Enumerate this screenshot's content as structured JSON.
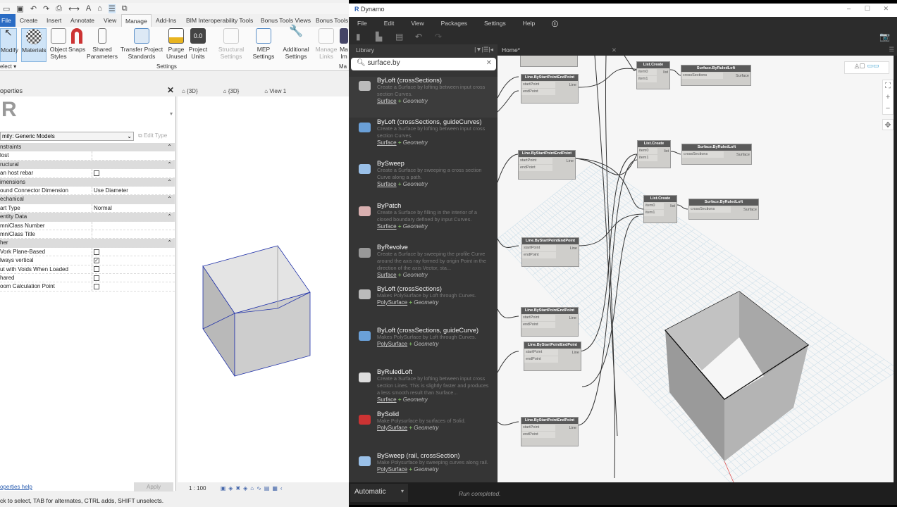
{
  "revit": {
    "tabs": [
      "File",
      "Create",
      "Insert",
      "Annotate",
      "View",
      "Manage",
      "Add-Ins",
      "BIM Interoperability Tools",
      "Bonus Tools Views",
      "Bonus Tools"
    ],
    "ribbon": {
      "modify": "Modify",
      "select": "elect",
      "materials": "Materials",
      "object_styles": "Object Styles",
      "snaps": "Snaps",
      "shared_parameters": "Shared Parameters",
      "transfer": "Transfer Project Standards",
      "purge": "Purge Unused",
      "project_units": "Project Units",
      "structural": "Structural Settings",
      "mep": "MEP Settings",
      "additional": "Additional Settings",
      "manage_links": "Manage Links",
      "ma": "Ma Im",
      "settings_group": "Settings",
      "ma_group": "Ma"
    },
    "properties": {
      "title": "operties",
      "family": "mily: Generic Models",
      "edit_type": "Edit Type",
      "help": "operties help",
      "apply": "Apply",
      "rows": [
        {
          "label": "nstraints",
          "group": true
        },
        {
          "label": "lost",
          "value": ""
        },
        {
          "label": "ructural",
          "group": true
        },
        {
          "label": "an host rebar",
          "check": false
        },
        {
          "label": "imensions",
          "group": true
        },
        {
          "label": "ound Connector Dimension",
          "value": "Use Diameter"
        },
        {
          "label": "echanical",
          "group": true
        },
        {
          "label": "art Type",
          "value": "Normal"
        },
        {
          "label": "entity Data",
          "group": true
        },
        {
          "label": "mniClass Number",
          "value": ""
        },
        {
          "label": "mniClass Title",
          "value": ""
        },
        {
          "label": "her",
          "group": true
        },
        {
          "label": "Vork Plane-Based",
          "check": false
        },
        {
          "label": "lways vertical",
          "check": true
        },
        {
          "label": "ut with Voids When Loaded",
          "check": false
        },
        {
          "label": "hared",
          "check": false
        },
        {
          "label": "oom Calculation Point",
          "check": false
        }
      ]
    },
    "view_tabs": [
      "{3D}",
      "{3D}",
      "View 1"
    ],
    "scale": "1 : 100",
    "status": "ck to select, TAB for alternates, CTRL adds, SHIFT unselects."
  },
  "dynamo": {
    "title": "Dynamo",
    "menu": [
      "File",
      "Edit",
      "View",
      "Packages",
      "Settings",
      "Help"
    ],
    "library_title": "Library",
    "search": "surface.by",
    "home_tab": "Home*",
    "items": [
      {
        "name": "ByLoft",
        "args": " (crossSections)",
        "desc": "Create a Surface by lofting between input cross section Curves.",
        "cat": "Surface",
        "lib": "Geometry",
        "color": "#bbb"
      },
      {
        "name": "ByLoft",
        "args": " (crossSections, guideCurves)",
        "desc": "Create a Surface by lofting between input cross section Curves.",
        "cat": "Surface",
        "lib": "Geometry",
        "color": "#6aa0d8"
      },
      {
        "name": "BySweep",
        "args": "",
        "desc": "Create a Surface by sweeping a cross section Curve along a path.",
        "cat": "Surface",
        "lib": "Geometry",
        "color": "#9ac0e8"
      },
      {
        "name": "ByPatch",
        "args": "",
        "desc": "Create a Surface by filling in the interior of a closed boundary defined by input Curves.",
        "cat": "Surface",
        "lib": "Geometry",
        "color": "#d9b0b0"
      },
      {
        "name": "ByRevolve",
        "args": "",
        "desc": "Create a Surface by sweeping the profile Curve around the axis ray formed by origin Point in the direction of the axis Vector, sta...",
        "cat": "Surface",
        "lib": "Geometry",
        "color": "#999"
      },
      {
        "name": "ByLoft",
        "args": " (crossSections)",
        "desc": "Makes PolySurface by Loft through Curves.",
        "cat": "PolySurface",
        "lib": "Geometry",
        "color": "#bbb"
      },
      {
        "name": "ByLoft",
        "args": " (crossSections, guideCurve)",
        "desc": "Makes PolySurface by Loft through Curves.",
        "cat": "PolySurface",
        "lib": "Geometry",
        "color": "#6aa0d8"
      },
      {
        "name": "ByRuledLoft",
        "args": "",
        "desc": "Create a Surface by lofting between input cross section Lines. This is slightly faster and produces a less smooth result than Surface...",
        "cat": "Surface",
        "lib": "Geometry",
        "color": "#ddd"
      },
      {
        "name": "BySolid",
        "args": "",
        "desc": "Make Polysurface by surfaces of Solid.",
        "cat": "PolySurface",
        "lib": "Geometry",
        "color": "#c33"
      },
      {
        "name": "BySweep",
        "args": " (rail, crossSection)",
        "desc": "Make Polysurface by sweeping curves along rail.",
        "cat": "PolySurface",
        "lib": "Geometry",
        "color": "#9ac0e8"
      }
    ],
    "nodes": {
      "line": "Line.ByStartPointEndPoint",
      "start": "startPoint",
      "end": "endPoint",
      "line_out": "Line",
      "list": "List.Create",
      "item0": "item0",
      "item1": "item1",
      "list_out": "list",
      "loft": "Surface.ByRuledLoft",
      "cross": "crossSections",
      "surface_out": "Surface"
    },
    "run_mode": "Automatic",
    "run_status": "Run completed."
  }
}
